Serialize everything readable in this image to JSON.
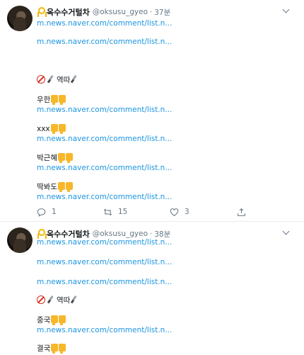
{
  "tweets": [
    {
      "display_name": "옥수수거털차",
      "handle": "@oksusu_gyeo",
      "separator": "·",
      "time": "37분",
      "link1": "m.news.naver.com/comment/list.n...",
      "link2": "m.news.naver.com/comment/list.n...",
      "banned_text": "역따",
      "items": [
        {
          "label": "우한",
          "link": "m.news.naver.com/comment/list.n..."
        },
        {
          "label": "xxx",
          "link": "m.news.naver.com/comment/list.n..."
        },
        {
          "label": "박근혜",
          "link": "m.news.naver.com/comment/list.n..."
        },
        {
          "label": "딱봐도",
          "link": "m.news.naver.com/comment/list.n..."
        }
      ],
      "reply_count": "1",
      "retweet_count": "15",
      "like_count": "3"
    },
    {
      "display_name": "옥수수거털차",
      "handle": "@oksusu_gyeo",
      "separator": "·",
      "time": "38분",
      "link1": "m.news.naver.com/comment/list.n...",
      "link2": "m.news.naver.com/comment/list.n...",
      "banned_text": "역따",
      "items": [
        {
          "label": "중국",
          "link": "m.news.naver.com/comment/list.n..."
        },
        {
          "label": "결국",
          "link": ""
        }
      ]
    }
  ],
  "icons": {
    "reply": "reply-icon",
    "retweet": "retweet-icon",
    "like": "heart-icon",
    "share": "share-icon",
    "more": "chevron-down-icon",
    "thumbs": "thumbs-down-icon",
    "ribbon": "yellow-ribbon-icon"
  },
  "colors": {
    "link": "#1b95e0",
    "secondary": "#657786",
    "thumb": "#f7b72a",
    "prohibited": "#d62d20",
    "ribbon": "#f2b705"
  }
}
